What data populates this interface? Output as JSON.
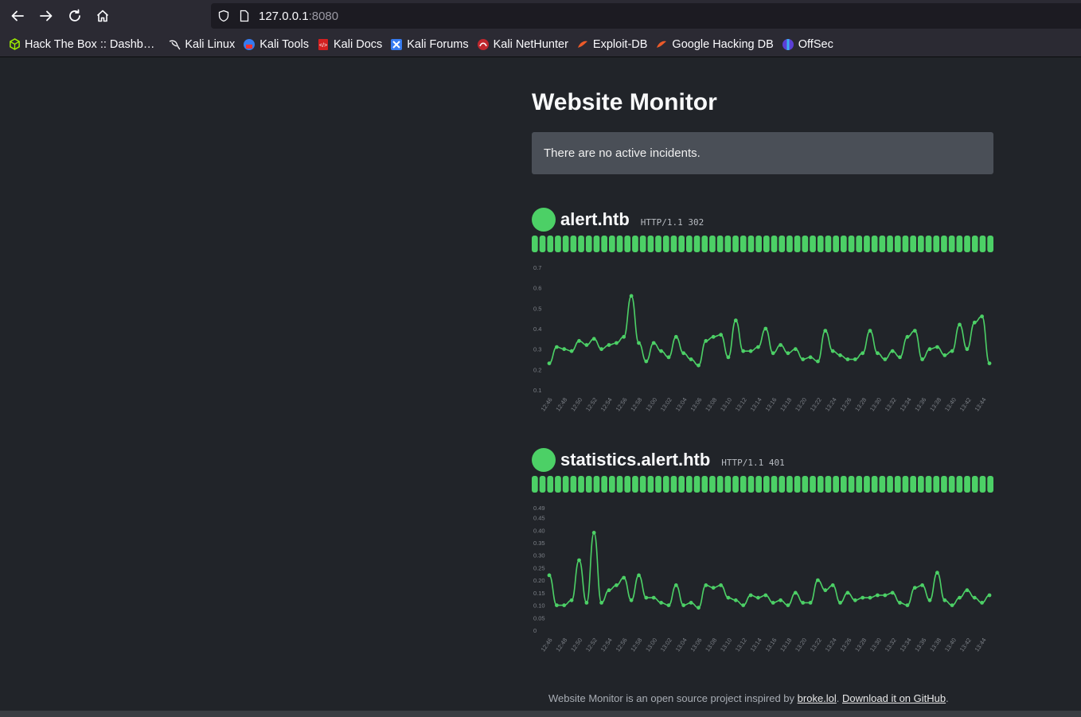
{
  "browser": {
    "url_host": "127.0.0.1",
    "url_port": ":8080",
    "bookmarks": [
      {
        "label": "Hack The Box :: Dashb…",
        "icon": "htb-cube-icon"
      },
      {
        "label": "Kali Linux",
        "icon": "kali-dragon-icon"
      },
      {
        "label": "Kali Tools",
        "icon": "kali-tools-icon"
      },
      {
        "label": "Kali Docs",
        "icon": "kali-docs-icon"
      },
      {
        "label": "Kali Forums",
        "icon": "kali-forums-icon"
      },
      {
        "label": "Kali NetHunter",
        "icon": "kali-nethunter-icon"
      },
      {
        "label": "Exploit-DB",
        "icon": "exploit-db-icon"
      },
      {
        "label": "Google Hacking DB",
        "icon": "ghdb-icon"
      },
      {
        "label": "OffSec",
        "icon": "offsec-icon"
      }
    ]
  },
  "page": {
    "title": "Website Monitor",
    "incident_text": "There are no active incidents.",
    "footer_prefix": "Website Monitor is an open source project inspired by ",
    "footer_link1": "broke.lol",
    "footer_sep": ". ",
    "footer_link2": "Download it on GitHub",
    "footer_suffix": "."
  },
  "colors": {
    "up": "#4cd066",
    "background": "#212429",
    "incident_bg": "#4a4f57"
  },
  "monitors": [
    {
      "name": "alert.htb",
      "status": "HTTP/1.1 302",
      "uptime_checks": 60,
      "status_up_ratio": 1.0,
      "chart_data": {
        "type": "line",
        "title": "",
        "xlabel": "",
        "ylabel": "",
        "ylim": [
          0.1,
          0.7
        ],
        "yticks": [
          "0.1",
          "0.2",
          "0.3",
          "0.4",
          "0.5",
          "0.6",
          "0.7"
        ],
        "ytick_values": [
          0.1,
          0.2,
          0.3,
          0.4,
          0.5,
          0.6,
          0.7
        ],
        "xticks": [
          "12:46",
          "12:48",
          "12:50",
          "12:52",
          "12:54",
          "12:56",
          "12:58",
          "13:00",
          "13:02",
          "13:04",
          "13:06",
          "13:08",
          "13:10",
          "13:12",
          "13:14",
          "13:16",
          "13:18",
          "13:20",
          "13:22",
          "13:24",
          "13:26",
          "13:28",
          "13:30",
          "13:32",
          "13:34",
          "13:36",
          "13:38",
          "13:40",
          "13:42",
          "13:44"
        ],
        "series": [
          {
            "values": [
              0.23,
              0.31,
              0.3,
              0.29,
              0.34,
              0.32,
              0.35,
              0.3,
              0.32,
              0.33,
              0.36,
              0.56,
              0.33,
              0.24,
              0.33,
              0.29,
              0.26,
              0.36,
              0.28,
              0.25,
              0.22,
              0.34,
              0.36,
              0.37,
              0.26,
              0.44,
              0.29,
              0.29,
              0.31,
              0.4,
              0.28,
              0.32,
              0.28,
              0.3,
              0.25,
              0.26,
              0.24,
              0.39,
              0.29,
              0.27,
              0.25,
              0.25,
              0.28,
              0.39,
              0.28,
              0.25,
              0.29,
              0.26,
              0.36,
              0.39,
              0.25,
              0.3,
              0.31,
              0.27,
              0.29,
              0.42,
              0.3,
              0.43,
              0.46,
              0.23
            ]
          }
        ]
      }
    },
    {
      "name": "statistics.alert.htb",
      "status": "HTTP/1.1 401",
      "uptime_checks": 60,
      "status_up_ratio": 1.0,
      "chart_data": {
        "type": "line",
        "title": "",
        "xlabel": "",
        "ylabel": "",
        "ylim": [
          0,
          0.49
        ],
        "yticks": [
          "0",
          "0.05",
          "0.10",
          "0.15",
          "0.20",
          "0.25",
          "0.30",
          "0.35",
          "0.40",
          "0.45",
          "0.49"
        ],
        "ytick_values": [
          0,
          0.05,
          0.1,
          0.15,
          0.2,
          0.25,
          0.3,
          0.35,
          0.4,
          0.45,
          0.49
        ],
        "xticks": [
          "12:46",
          "12:48",
          "12:50",
          "12:52",
          "12:54",
          "12:56",
          "12:58",
          "13:00",
          "13:02",
          "13:04",
          "13:06",
          "13:08",
          "13:10",
          "13:12",
          "13:14",
          "13:16",
          "13:18",
          "13:20",
          "13:22",
          "13:24",
          "13:26",
          "13:28",
          "13:30",
          "13:32",
          "13:34",
          "13:36",
          "13:38",
          "13:40",
          "13:42",
          "13:44"
        ],
        "series": [
          {
            "values": [
              0.22,
              0.1,
              0.1,
              0.12,
              0.28,
              0.11,
              0.39,
              0.11,
              0.16,
              0.18,
              0.21,
              0.12,
              0.22,
              0.13,
              0.13,
              0.11,
              0.1,
              0.18,
              0.1,
              0.11,
              0.09,
              0.18,
              0.17,
              0.18,
              0.13,
              0.12,
              0.1,
              0.14,
              0.13,
              0.14,
              0.11,
              0.12,
              0.1,
              0.15,
              0.11,
              0.11,
              0.2,
              0.16,
              0.18,
              0.11,
              0.15,
              0.12,
              0.13,
              0.13,
              0.14,
              0.14,
              0.15,
              0.11,
              0.1,
              0.17,
              0.18,
              0.12,
              0.23,
              0.12,
              0.1,
              0.13,
              0.16,
              0.13,
              0.11,
              0.14
            ]
          }
        ]
      }
    }
  ]
}
